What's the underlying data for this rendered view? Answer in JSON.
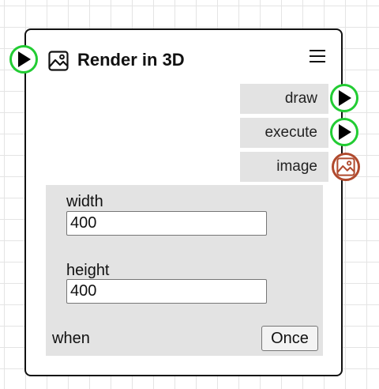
{
  "node": {
    "title": "Render in 3D",
    "title_icon": "image-icon",
    "menu_icon": "hamburger-menu-icon"
  },
  "outputs": [
    {
      "label": "draw",
      "port_icon": "play-icon"
    },
    {
      "label": "execute",
      "port_icon": "play-icon"
    },
    {
      "label": "image",
      "port_icon": "image-icon"
    }
  ],
  "params": {
    "width": {
      "label": "width",
      "value": "400"
    },
    "height": {
      "label": "height",
      "value": "400"
    },
    "when": {
      "label": "when",
      "button_label": "Once"
    }
  },
  "colors": {
    "exec_port": "#22cc33",
    "image_port": "#b04a2e",
    "panel_bg": "#e3e3e3",
    "border": "#111111"
  }
}
